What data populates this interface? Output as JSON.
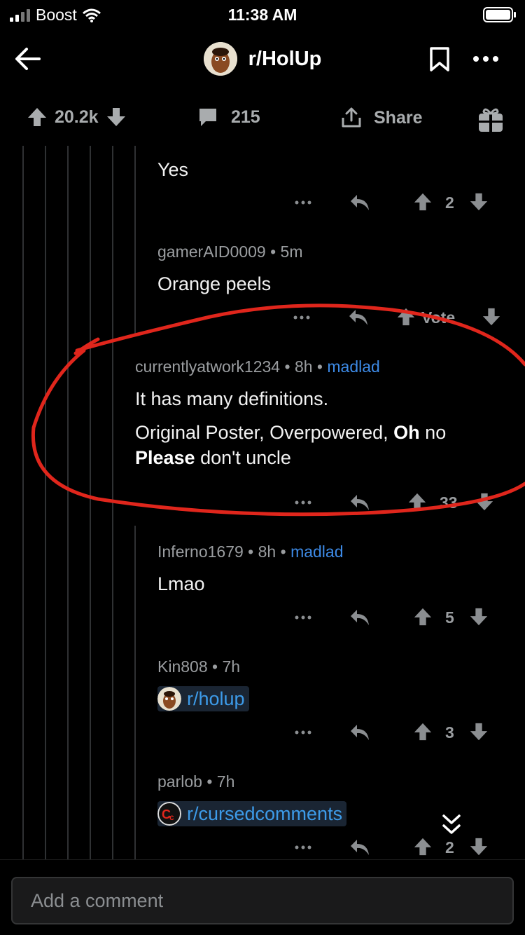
{
  "status_bar": {
    "carrier": "Boost",
    "time": "11:38 AM"
  },
  "header": {
    "subreddit": "r/HolUp"
  },
  "post_actions": {
    "score": "20.2k",
    "comments": "215",
    "share_label": "Share"
  },
  "comments": [
    {
      "body": "Yes",
      "score": "2"
    },
    {
      "user": "gamerAID0009",
      "age": "5m",
      "body": "Orange peels",
      "score": "Vote"
    },
    {
      "user": "currentlyatwork1234",
      "age": "8h",
      "flair": "madlad",
      "body_p1": "It has many definitions.",
      "body_p2a": "Original Poster, Overpowered, ",
      "body_p2b": "Oh",
      "body_p2c": " no ",
      "body_p2d": "Please",
      "body_p2e": " don't uncle",
      "score": "33"
    },
    {
      "user": "Inferno1679",
      "age": "8h",
      "flair": "madlad",
      "body": "Lmao",
      "score": "5"
    },
    {
      "user": "Kin808",
      "age": "7h",
      "link": "r/holup",
      "score": "3"
    },
    {
      "user": "parlob",
      "age": "7h",
      "link": "r/cursedcomments",
      "score": "2"
    }
  ],
  "input": {
    "placeholder": "Add a comment"
  },
  "colors": {
    "flair": "#3d8ae6",
    "link": "#3d9be9",
    "annotation": "#e0261c"
  }
}
